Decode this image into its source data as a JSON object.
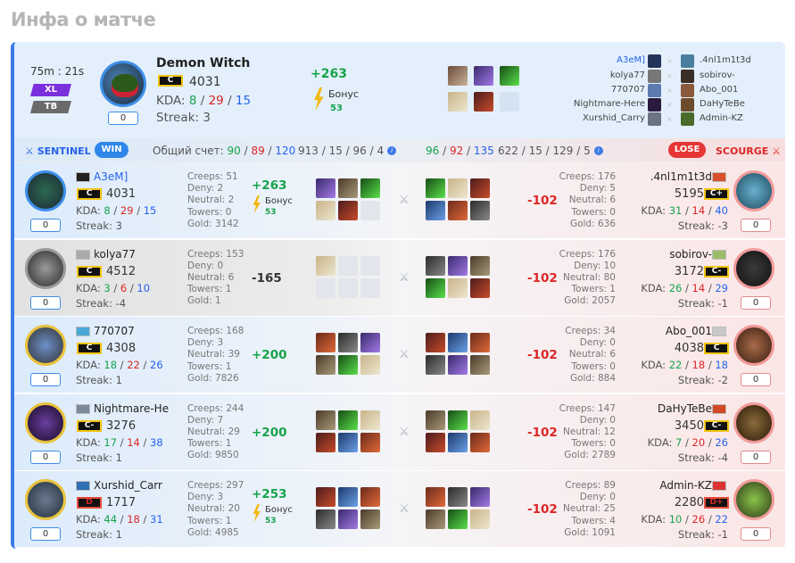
{
  "title": "Инфа о матче",
  "header": {
    "duration": "75m : 21s",
    "tag_xl": "XL",
    "tag_tb": "TB",
    "counter": "0",
    "player_name": "Demon Witch",
    "rank": "C",
    "mmr": "4031",
    "kda_label": "KDA:",
    "k": "8",
    "d": "29",
    "a": "15",
    "streak_label": "Streak:",
    "streak": "3",
    "points": "+263",
    "bonus_label": "Бонус",
    "bonus_value": "53"
  },
  "lobby": {
    "left": [
      "A3eM]",
      "kolya77",
      "770707",
      "Nightmare-Here",
      "Xurshid_Carry"
    ],
    "right": [
      ".4nl1m1t3d",
      "sobirov-",
      "Abo_001",
      "DaHyTeBe",
      "Admin-KZ"
    ]
  },
  "bar": {
    "sentinel": "SENTINEL",
    "win": "WIN",
    "score_label": "Общий счет:",
    "score_g": "90",
    "score_r": "89",
    "score_t": "120",
    "left_stats": "913 / 15 / 96 / 4",
    "r_g": "96",
    "r_r": "92",
    "r_t": "135",
    "right_stats": "622 / 15 / 129 / 5",
    "lose": "LOSE",
    "scourge": "SCOURGE"
  },
  "rows": [
    {
      "lname": "A3eM]",
      "lrank": "C",
      "lmmr": "4031",
      "lk": "8",
      "ld": "29",
      "la": "15",
      "lstreak": "3",
      "lcnt": "0",
      "lcreeps": "Creeps: 51",
      "ldeny": "Deny: 2",
      "lneutral": "Neutral: 2",
      "ltowers": "Towers: 0",
      "lgold": "Gold: 3142",
      "lpts": "+263",
      "lbonus": true,
      "lbonus_label": "Бонус",
      "lbonus_v": "53",
      "rpts": "-102",
      "rcreeps": "Creeps: 176",
      "rdeny": "Deny: 5",
      "rneutral": "Neutral: 6",
      "rtowers": "Towers: 0",
      "rgold": "Gold: 636",
      "rname": ".4nl1m1t3d",
      "rrank": "C+",
      "rmmr": "5195",
      "rk": "31",
      "rd": "14",
      "ra": "40",
      "rstreak": "-3",
      "rcnt": "0"
    },
    {
      "lname": "kolya77",
      "lrank": "C",
      "lmmr": "4512",
      "lk": "3",
      "ld": "6",
      "la": "10",
      "lstreak": "-4",
      "lcnt": "0",
      "lcreeps": "Creeps: 153",
      "ldeny": "Deny: 0",
      "lneutral": "Neutral: 6",
      "ltowers": "Towers: 1",
      "lgold": "Gold: 1",
      "lpts": "-165",
      "rpts": "-102",
      "rcreeps": "Creeps: 176",
      "rdeny": "Deny: 10",
      "rneutral": "Neutral: 80",
      "rtowers": "Towers: 1",
      "rgold": "Gold: 2057",
      "rname": "sobirov-",
      "rrank": "C-",
      "rmmr": "3172",
      "rk": "26",
      "rd": "14",
      "ra": "29",
      "rstreak": "-1",
      "rcnt": "0"
    },
    {
      "lname": "770707",
      "lrank": "C",
      "lmmr": "4308",
      "lk": "18",
      "ld": "22",
      "la": "26",
      "lstreak": "1",
      "lcnt": "0",
      "lcreeps": "Creeps: 168",
      "ldeny": "Deny: 3",
      "lneutral": "Neutral: 39",
      "ltowers": "Towers: 1",
      "lgold": "Gold: 7826",
      "lpts": "+200",
      "rpts": "-102",
      "rcreeps": "Creeps: 34",
      "rdeny": "Deny: 0",
      "rneutral": "Neutral: 6",
      "rtowers": "Towers: 0",
      "rgold": "Gold: 884",
      "rname": "Abo_001",
      "rrank": "C",
      "rmmr": "4038",
      "rk": "22",
      "rd": "18",
      "ra": "18",
      "rstreak": "-2",
      "rcnt": "0"
    },
    {
      "lname": "Nightmare-He",
      "lrank": "C-",
      "lmmr": "3276",
      "lk": "17",
      "ld": "14",
      "la": "38",
      "lstreak": "1",
      "lcnt": "0",
      "lcreeps": "Creeps: 244",
      "ldeny": "Deny: 7",
      "lneutral": "Neutral: 29",
      "ltowers": "Towers: 1",
      "lgold": "Gold: 9850",
      "lpts": "+200",
      "rpts": "-102",
      "rcreeps": "Creeps: 147",
      "rdeny": "Deny: 0",
      "rneutral": "Neutral: 12",
      "rtowers": "Towers: 0",
      "rgold": "Gold: 2789",
      "rname": "DaHyTeBe",
      "rrank": "C-",
      "rmmr": "3450",
      "rk": "7",
      "rd": "20",
      "ra": "26",
      "rstreak": "-4",
      "rcnt": "0"
    },
    {
      "lname": "Xurshid_Carr",
      "lrank": "D",
      "lmmr": "1717",
      "lk": "44",
      "ld": "18",
      "la": "31",
      "lstreak": "1",
      "lcnt": "0",
      "lcreeps": "Creeps: 297",
      "ldeny": "Deny: 3",
      "lneutral": "Neutral: 20",
      "ltowers": "Towers: 1",
      "lgold": "Gold: 4985",
      "lpts": "+253",
      "lbonus": true,
      "lbonus_label": "Бонус",
      "lbonus_v": "53",
      "rpts": "-102",
      "rcreeps": "Creeps: 89",
      "rdeny": "Deny: 0",
      "rneutral": "Neutral: 25",
      "rtowers": "Towers: 4",
      "rgold": "Gold: 1091",
      "rname": "Admin-KZ",
      "rrank": "D+",
      "rmmr": "2280",
      "rk": "10",
      "rd": "26",
      "ra": "22",
      "rstreak": "-1",
      "rcnt": "0"
    }
  ],
  "labels": {
    "kda": "KDA:",
    "streak": "Streak:"
  },
  "colors": {
    "accent": "#3b7be8",
    "win": "#16a34a",
    "loss": "#dc2626",
    "rank_border": "#f1c40f"
  }
}
